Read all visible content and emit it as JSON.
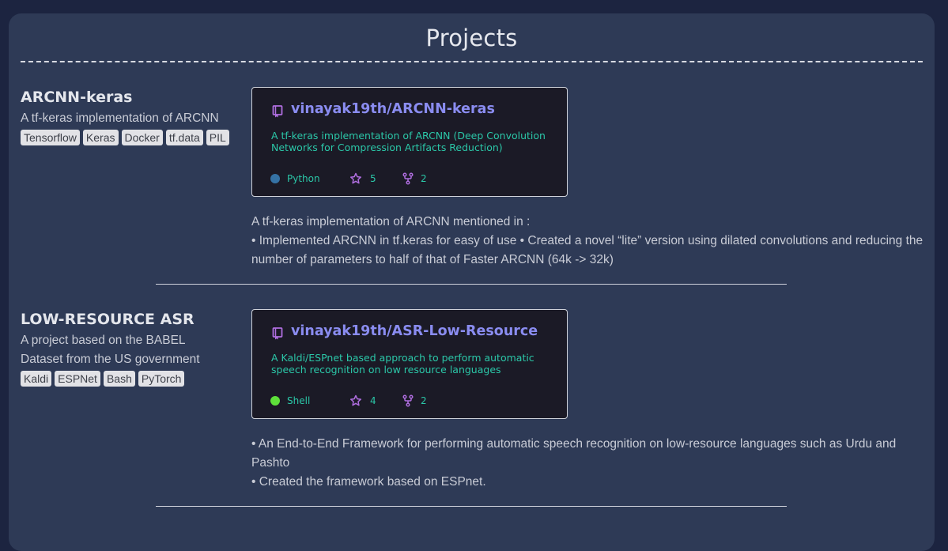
{
  "page": {
    "title": "Projects"
  },
  "projects": [
    {
      "name": "ARCNN-keras",
      "subtitle": "A tf-keras implementation of ARCNN",
      "tags": [
        "Tensorflow",
        "Keras",
        "Docker",
        "tf.data",
        "PIL"
      ],
      "repo": {
        "name": "vinayak19th/ARCNN-keras",
        "description": "A tf-keras implementation of ARCNN (Deep Convolution Networks for Compression Artifacts Reduction)",
        "language": "Python",
        "language_color": "#3572A5",
        "stars": "5",
        "forks": "2"
      },
      "details": [
        "A tf-keras implementation of ARCNN mentioned in :",
        "• Implemented ARCNN in tf.keras for easy of use • Created a novel “lite” version using dilated convolutions and reducing the number of parameters to half of that of Faster ARCNN (64k -> 32k)"
      ]
    },
    {
      "name": "LOW-RESOURCE ASR",
      "subtitle": "A project based on the BABEL Dataset from the US government",
      "tags": [
        "Kaldi",
        "ESPNet",
        "Bash",
        "PyTorch"
      ],
      "repo": {
        "name": "vinayak19th/ASR-Low-Resource",
        "description": "A Kaldi/ESPnet based approach to perform automatic speech recognition on low resource languages",
        "language": "Shell",
        "language_color": "#89e051",
        "stars": "4",
        "forks": "2"
      },
      "details": [
        "• An End-to-End Framework for performing automatic speech recognition on low-resource languages such as Urdu and Pashto",
        "• Created the framework based on ESPnet."
      ]
    }
  ],
  "icons": {
    "repo": "repo-icon",
    "star": "star-icon",
    "fork": "fork-icon"
  },
  "colors": {
    "background": "#1c2440",
    "panel": "#2e3a56",
    "card": "#1b1a26",
    "repo_link": "#8a8cf0",
    "card_text": "#2bc7a8",
    "icon": "#b06ee0"
  }
}
